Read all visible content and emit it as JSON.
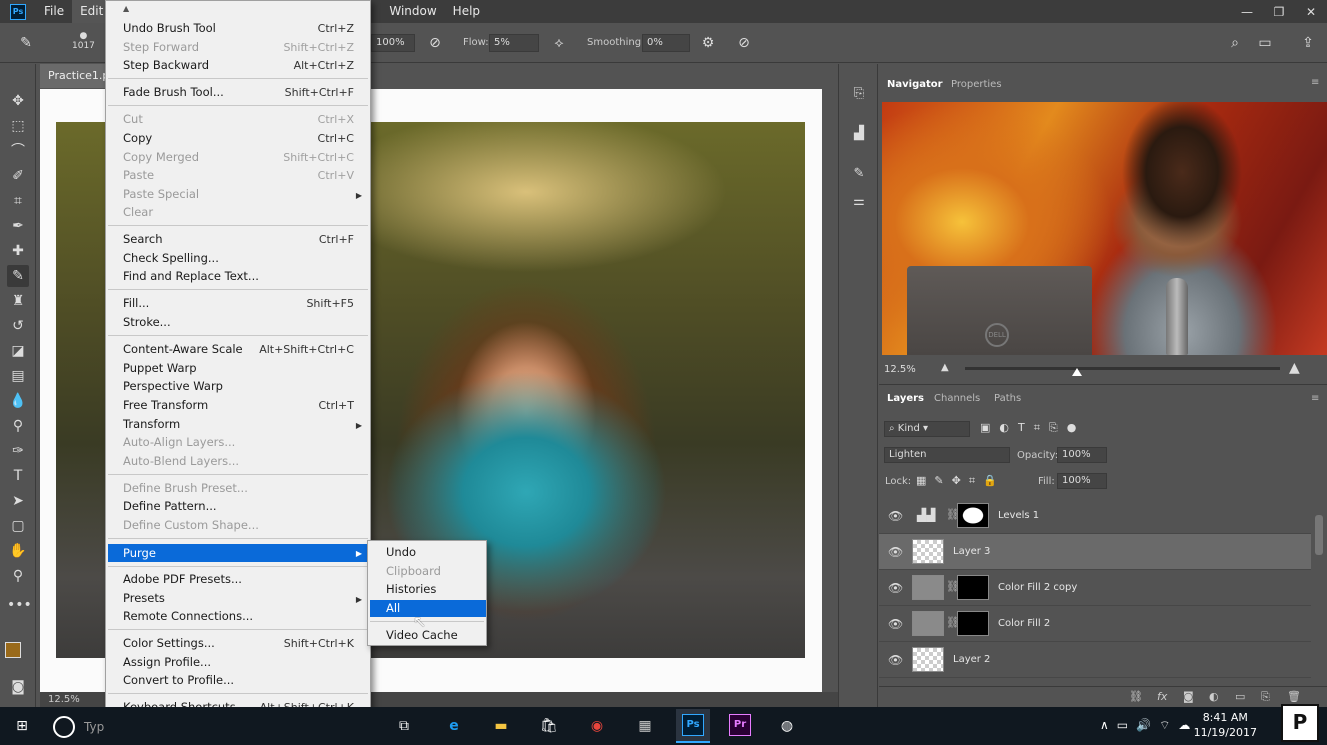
{
  "menubar": {
    "logo": "Ps",
    "items": [
      "File",
      "Edit",
      "Window",
      "Help"
    ]
  },
  "options_bar": {
    "brush_size": "1017",
    "opacity_value": "100%",
    "flow_label": "Flow:",
    "flow_value": "5%",
    "smoothing_label": "Smoothing:",
    "smoothing_value": "0%"
  },
  "document": {
    "tab_title": "Practice1.p",
    "zoom": "12.5%"
  },
  "edit_menu": {
    "items": [
      {
        "label": "Undo Brush Tool",
        "shortcut": "Ctrl+Z",
        "enabled": true
      },
      {
        "label": "Step Forward",
        "shortcut": "Shift+Ctrl+Z",
        "enabled": false
      },
      {
        "label": "Step Backward",
        "shortcut": "Alt+Ctrl+Z",
        "enabled": true
      },
      {
        "label": "Fade Brush Tool...",
        "shortcut": "Shift+Ctrl+F",
        "enabled": true
      },
      {
        "label": "Cut",
        "shortcut": "Ctrl+X",
        "enabled": false
      },
      {
        "label": "Copy",
        "shortcut": "Ctrl+C",
        "enabled": true
      },
      {
        "label": "Copy Merged",
        "shortcut": "Shift+Ctrl+C",
        "enabled": false
      },
      {
        "label": "Paste",
        "shortcut": "Ctrl+V",
        "enabled": false
      },
      {
        "label": "Paste Special",
        "shortcut": "",
        "enabled": false
      },
      {
        "label": "Clear",
        "shortcut": "",
        "enabled": false
      },
      {
        "label": "Search",
        "shortcut": "Ctrl+F",
        "enabled": true
      },
      {
        "label": "Check Spelling...",
        "shortcut": "",
        "enabled": true
      },
      {
        "label": "Find and Replace Text...",
        "shortcut": "",
        "enabled": true
      },
      {
        "label": "Fill...",
        "shortcut": "Shift+F5",
        "enabled": true
      },
      {
        "label": "Stroke...",
        "shortcut": "",
        "enabled": true
      },
      {
        "label": "Content-Aware Scale",
        "shortcut": "Alt+Shift+Ctrl+C",
        "enabled": true
      },
      {
        "label": "Puppet Warp",
        "shortcut": "",
        "enabled": true
      },
      {
        "label": "Perspective Warp",
        "shortcut": "",
        "enabled": true
      },
      {
        "label": "Free Transform",
        "shortcut": "Ctrl+T",
        "enabled": true
      },
      {
        "label": "Transform",
        "shortcut": "",
        "enabled": true
      },
      {
        "label": "Auto-Align Layers...",
        "shortcut": "",
        "enabled": false
      },
      {
        "label": "Auto-Blend Layers...",
        "shortcut": "",
        "enabled": false
      },
      {
        "label": "Define Brush Preset...",
        "shortcut": "",
        "enabled": false
      },
      {
        "label": "Define Pattern...",
        "shortcut": "",
        "enabled": true
      },
      {
        "label": "Define Custom Shape...",
        "shortcut": "",
        "enabled": false
      },
      {
        "label": "Purge",
        "shortcut": "",
        "enabled": true
      },
      {
        "label": "Adobe PDF Presets...",
        "shortcut": "",
        "enabled": true
      },
      {
        "label": "Presets",
        "shortcut": "",
        "enabled": true
      },
      {
        "label": "Remote Connections...",
        "shortcut": "",
        "enabled": true
      },
      {
        "label": "Color Settings...",
        "shortcut": "Shift+Ctrl+K",
        "enabled": true
      },
      {
        "label": "Assign Profile...",
        "shortcut": "",
        "enabled": true
      },
      {
        "label": "Convert to Profile...",
        "shortcut": "",
        "enabled": true
      },
      {
        "label": "Keyboard Shortcuts...",
        "shortcut": "Alt+Shift+Ctrl+K",
        "enabled": true
      }
    ]
  },
  "purge_submenu": {
    "items": [
      {
        "label": "Undo",
        "enabled": true
      },
      {
        "label": "Clipboard",
        "enabled": false
      },
      {
        "label": "Histories",
        "enabled": true
      },
      {
        "label": "All",
        "enabled": true
      },
      {
        "label": "Video Cache",
        "enabled": true
      }
    ]
  },
  "navigator": {
    "tabs": [
      "Navigator",
      "Properties"
    ],
    "zoom": "12.5%",
    "laptop_logo": "DELL"
  },
  "layers": {
    "tabs": [
      "Layers",
      "Channels",
      "Paths"
    ],
    "filter_kind": "Kind",
    "blend_mode": "Lighten",
    "opacity_label": "Opacity:",
    "opacity_value": "100%",
    "lock_label": "Lock:",
    "fill_label": "Fill:",
    "fill_value": "100%",
    "rows": [
      {
        "name": "Levels 1"
      },
      {
        "name": "Layer 3"
      },
      {
        "name": "Color Fill 2 copy"
      },
      {
        "name": "Color Fill 2"
      },
      {
        "name": "Layer 2"
      }
    ]
  },
  "taskbar": {
    "search_text": "Typ",
    "time": "8:41 AM",
    "date": "11/19/2017",
    "ps_label": "Ps",
    "pr_label": "Pr"
  },
  "watermark": "P"
}
